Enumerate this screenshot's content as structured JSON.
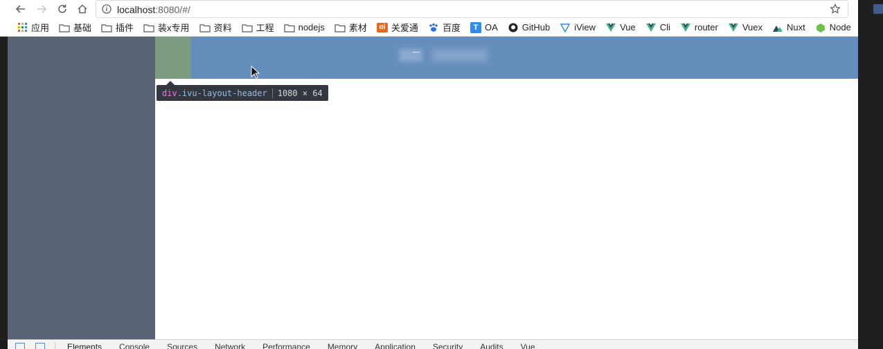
{
  "browser": {
    "url_host": "localhost",
    "url_path": ":8080/#/"
  },
  "bookmarks": [
    {
      "label": "应用",
      "icon": "apps-grid-icon"
    },
    {
      "label": "基础",
      "icon": "folder-icon"
    },
    {
      "label": "插件",
      "icon": "folder-icon"
    },
    {
      "label": "装x专用",
      "icon": "folder-icon"
    },
    {
      "label": "资料",
      "icon": "folder-icon"
    },
    {
      "label": "工程",
      "icon": "folder-icon"
    },
    {
      "label": "nodejs",
      "icon": "folder-icon"
    },
    {
      "label": "素材",
      "icon": "folder-icon"
    },
    {
      "label": "关爱通",
      "icon": "guanaitong-icon"
    },
    {
      "label": "百度",
      "icon": "baidu-paw-icon"
    },
    {
      "label": "OA",
      "icon": "oa-icon"
    },
    {
      "label": "GitHub",
      "icon": "github-icon"
    },
    {
      "label": "iView",
      "icon": "iview-icon"
    },
    {
      "label": "Vue",
      "icon": "vue-icon"
    },
    {
      "label": "Cli",
      "icon": "vue-icon"
    },
    {
      "label": "router",
      "icon": "vue-icon"
    },
    {
      "label": "Vuex",
      "icon": "vue-icon"
    },
    {
      "label": "Nuxt",
      "icon": "nuxt-icon"
    },
    {
      "label": "Node",
      "icon": "node-icon"
    }
  ],
  "inspect_tooltip": {
    "tag": "div",
    "class": ".ivu-layout-header",
    "size": "1080 × 64"
  },
  "devtools": {
    "tabs": [
      "Elements",
      "Console",
      "Sources",
      "Network",
      "Performance",
      "Memory",
      "Application",
      "Security",
      "Audits",
      "Vue"
    ],
    "active": "Elements"
  },
  "colors": {
    "sider": "#5b6376",
    "header": "#668ebd",
    "header_padding_highlight": "#7b9c81",
    "tooltip_bg": "#333740"
  }
}
